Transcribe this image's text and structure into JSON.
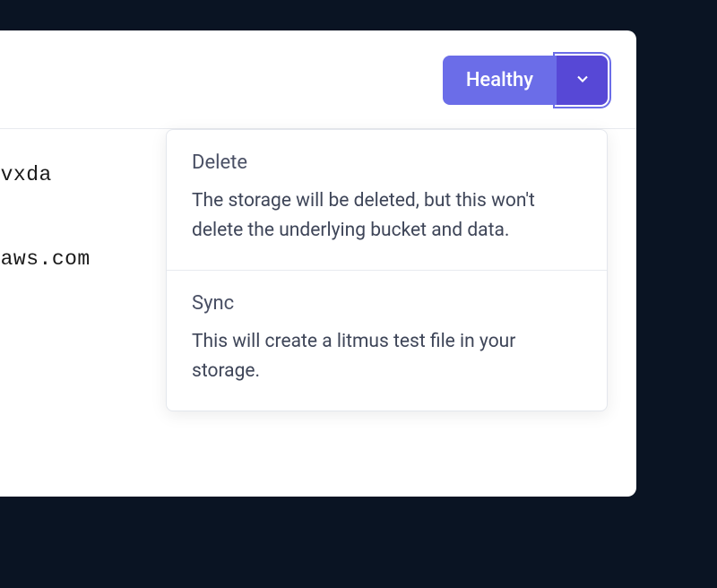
{
  "header": {
    "status_label": "Healthy"
  },
  "rows": {
    "row1": "cvvxda",
    "row2": "onaws.com"
  },
  "dropdown": {
    "items": [
      {
        "title": "Delete",
        "description": "The storage will be deleted, but this won't delete the underlying bucket and data."
      },
      {
        "title": "Sync",
        "description": "This will create a litmus test file in your storage."
      }
    ]
  }
}
